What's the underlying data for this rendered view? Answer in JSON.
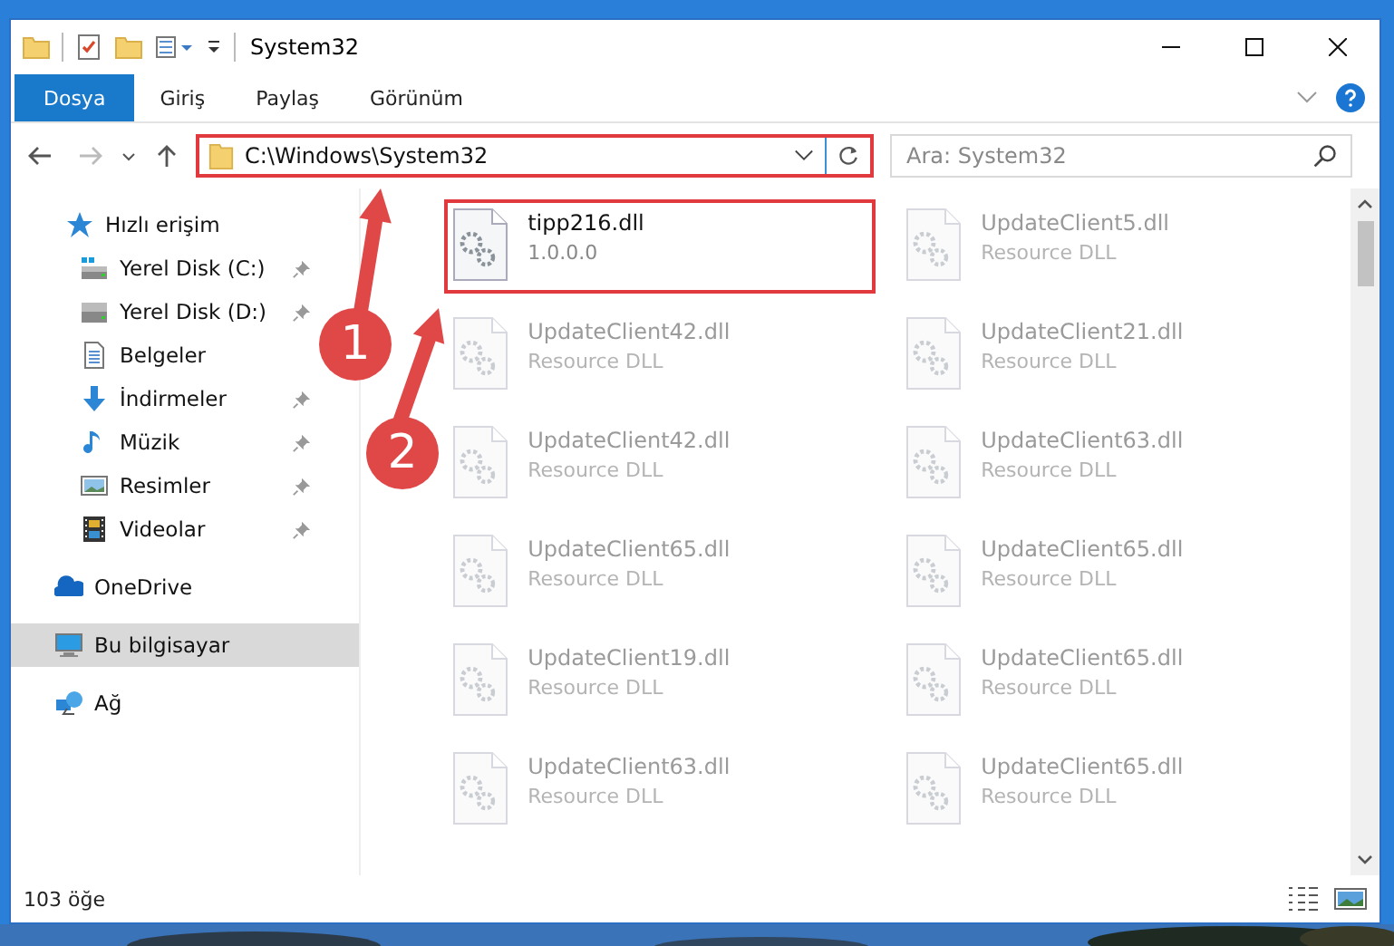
{
  "window": {
    "title": "System32"
  },
  "ribbon_tabs": [
    {
      "label": "Dosya",
      "selected": true
    },
    {
      "label": "Giriş",
      "selected": false
    },
    {
      "label": "Paylaş",
      "selected": false
    },
    {
      "label": "Görünüm",
      "selected": false
    }
  ],
  "address": {
    "path": "C:\\Windows\\System32",
    "highlighted": true
  },
  "search": {
    "placeholder": "Ara: System32"
  },
  "sidebar": {
    "items": [
      {
        "label": "Hızlı erişim",
        "kind": "star",
        "selected": false,
        "children": [
          {
            "label": "Yerel Disk (C:)",
            "kind": "systemdrive",
            "pinned": true,
            "selected": false
          },
          {
            "label": "Yerel Disk (D:)",
            "kind": "drive",
            "pinned": true,
            "selected": false
          },
          {
            "label": "Belgeler",
            "kind": "document",
            "pinned": false,
            "selected": false
          },
          {
            "label": "İndirmeler",
            "kind": "download",
            "pinned": true,
            "selected": false
          },
          {
            "label": "Müzik",
            "kind": "music",
            "pinned": true,
            "selected": false
          },
          {
            "label": "Resimler",
            "kind": "pictures",
            "pinned": true,
            "selected": false
          },
          {
            "label": "Videolar",
            "kind": "videos",
            "pinned": true,
            "selected": false
          }
        ]
      },
      {
        "label": "OneDrive",
        "kind": "cloud",
        "selected": false
      },
      {
        "label": "Bu bilgisayar",
        "kind": "computer",
        "selected": true
      },
      {
        "label": "Ağ",
        "kind": "network",
        "selected": false
      }
    ]
  },
  "files": [
    {
      "name": "tipp216.dll",
      "detail": "1.0.0.0",
      "highlighted": true,
      "blurred": false
    },
    {
      "name": "UpdateClient5.dll",
      "detail": "Resource DLL",
      "highlighted": false,
      "blurred": true
    },
    {
      "name": "UpdateClient42.dll",
      "detail": "Resource DLL",
      "highlighted": false,
      "blurred": true
    },
    {
      "name": "UpdateClient21.dll",
      "detail": "Resource DLL",
      "highlighted": false,
      "blurred": true
    },
    {
      "name": "UpdateClient42.dll",
      "detail": "Resource DLL",
      "highlighted": false,
      "blurred": true
    },
    {
      "name": "UpdateClient63.dll",
      "detail": "Resource DLL",
      "highlighted": false,
      "blurred": true
    },
    {
      "name": "UpdateClient65.dll",
      "detail": "Resource DLL",
      "highlighted": false,
      "blurred": true
    },
    {
      "name": "UpdateClient65.dll",
      "detail": "Resource DLL",
      "highlighted": false,
      "blurred": true
    },
    {
      "name": "UpdateClient19.dll",
      "detail": "Resource DLL",
      "highlighted": false,
      "blurred": true
    },
    {
      "name": "UpdateClient65.dll",
      "detail": "Resource DLL",
      "highlighted": false,
      "blurred": true
    },
    {
      "name": "UpdateClient63.dll",
      "detail": "Resource DLL",
      "highlighted": false,
      "blurred": true
    },
    {
      "name": "UpdateClient65.dll",
      "detail": "Resource DLL",
      "highlighted": false,
      "blurred": true
    }
  ],
  "status_bar": {
    "count": "103 öğe"
  },
  "annotations": [
    {
      "number": "1"
    },
    {
      "number": "2"
    }
  ]
}
